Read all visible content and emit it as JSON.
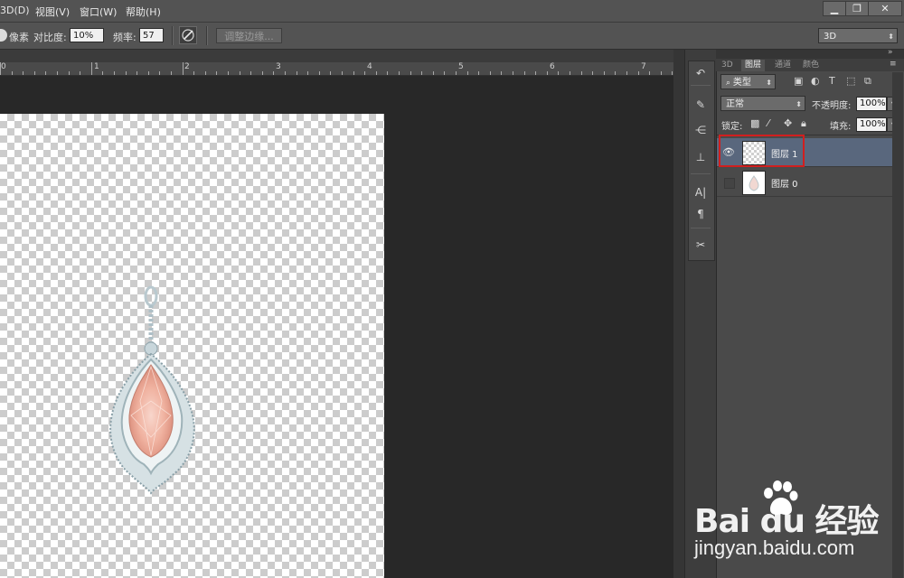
{
  "menubar": {
    "items": [
      "3D(D)",
      "视图(V)",
      "窗口(W)",
      "帮助(H)"
    ],
    "window_controls": [
      "▁",
      "❐",
      "✕"
    ]
  },
  "options_bar": {
    "width_unit": "像素",
    "contrast_label": "对比度:",
    "contrast_value": "10%",
    "frequency_label": "频率:",
    "frequency_value": "57",
    "pen_pressure_icon": "pen-pressure-icon",
    "refine_edge_label": "调整边缘...",
    "workspace_select": "3D"
  },
  "ruler": {
    "labels": [
      "0",
      "1",
      "2",
      "3",
      "4",
      "5",
      "6",
      "7"
    ]
  },
  "panel": {
    "tabs": [
      "3D",
      "图层",
      "通道",
      "颜色"
    ],
    "active_tab": "图层",
    "filter_kind": "类型",
    "blend_mode": "正常",
    "opacity_label": "不透明度:",
    "opacity_value": "100%",
    "lock_label": "锁定:",
    "fill_label": "填充:",
    "fill_value": "100%",
    "layers": [
      {
        "name": "图层 1",
        "visible": true,
        "selected": true
      },
      {
        "name": "图层 0",
        "visible": false,
        "selected": false
      }
    ]
  },
  "watermark": {
    "logo": "Bai du 经验",
    "url": "jingyan.baidu.com"
  }
}
